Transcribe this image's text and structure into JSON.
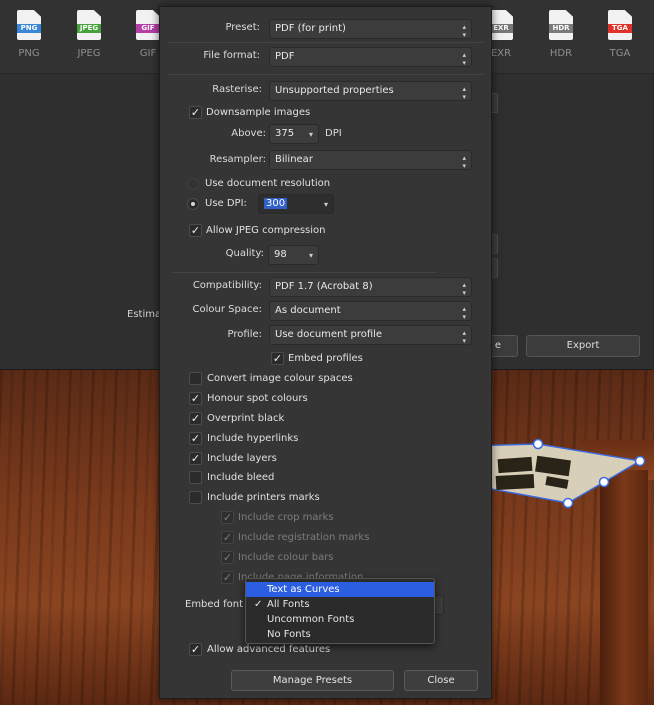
{
  "background": {
    "formats": [
      {
        "label": "PNG",
        "tag": "PNG",
        "color": "#3a87d8",
        "icon": "png-file-icon"
      },
      {
        "label": "JPEG",
        "tag": "JPEG",
        "color": "#46a23a",
        "icon": "jpeg-file-icon"
      },
      {
        "label": "GIF",
        "tag": "GIF",
        "color": "#b53fa8",
        "icon": "gif-file-icon"
      },
      {
        "label": "EXR",
        "tag": "EXR",
        "color": "#777777",
        "icon": "exr-file-icon"
      },
      {
        "label": "HDR",
        "tag": "HDR",
        "color": "#7a7a7a",
        "icon": "hdr-file-icon"
      },
      {
        "label": "TGA",
        "tag": "TGA",
        "color": "#e0322a",
        "icon": "tga-file-icon"
      }
    ],
    "estimated_label": "Estima",
    "partial_button_label": "e",
    "export_label": "Export"
  },
  "dialog": {
    "preset": {
      "label": "Preset:",
      "value": "PDF (for print)"
    },
    "file_format": {
      "label": "File format:",
      "value": "PDF"
    },
    "rasterise": {
      "label": "Rasterise:",
      "value": "Unsupported properties"
    },
    "downsample": {
      "label": "Downsample images",
      "checked": true
    },
    "above": {
      "label": "Above:",
      "value": "375",
      "unit": "DPI"
    },
    "resampler": {
      "label": "Resampler:",
      "value": "Bilinear"
    },
    "use_document_resolution": {
      "label": "Use document resolution"
    },
    "use_dpi": {
      "label": "Use DPI:",
      "value": "300"
    },
    "jpeg_compression": {
      "label": "Allow JPEG compression",
      "checked": true
    },
    "quality": {
      "label": "Quality:",
      "value": "98"
    },
    "compatibility": {
      "label": "Compatibility:",
      "value": "PDF 1.7 (Acrobat 8)"
    },
    "colour_space": {
      "label": "Colour Space:",
      "value": "As document"
    },
    "profile": {
      "label": "Profile:",
      "value": "Use document profile"
    },
    "embed_profiles": {
      "label": "Embed profiles",
      "checked": true
    },
    "options": [
      {
        "label": "Convert image colour spaces",
        "checked": false
      },
      {
        "label": "Honour spot colours",
        "checked": true
      },
      {
        "label": "Overprint black",
        "checked": true
      },
      {
        "label": "Include hyperlinks",
        "checked": true
      },
      {
        "label": "Include layers",
        "checked": true
      },
      {
        "label": "Include bleed",
        "checked": false
      },
      {
        "label": "Include printers marks",
        "checked": false
      }
    ],
    "printer_marks": [
      {
        "label": "Include crop marks",
        "checked": true
      },
      {
        "label": "Include registration marks",
        "checked": true
      },
      {
        "label": "Include colour bars",
        "checked": true
      },
      {
        "label": "Include page information",
        "checked": true
      }
    ],
    "embed_fonts": {
      "label": "Embed  font"
    },
    "allow_advanced": {
      "label": "Allow advanced features",
      "checked": true
    },
    "manage_presets_label": "Manage Presets",
    "close_label": "Close"
  },
  "embed_menu": {
    "items": [
      {
        "label": "Text as Curves",
        "highlighted": true,
        "checked": false
      },
      {
        "label": "All Fonts",
        "highlighted": false,
        "checked": true
      },
      {
        "label": "Uncommon Fonts",
        "highlighted": false,
        "checked": false
      },
      {
        "label": "No Fonts",
        "highlighted": false,
        "checked": false
      }
    ]
  }
}
